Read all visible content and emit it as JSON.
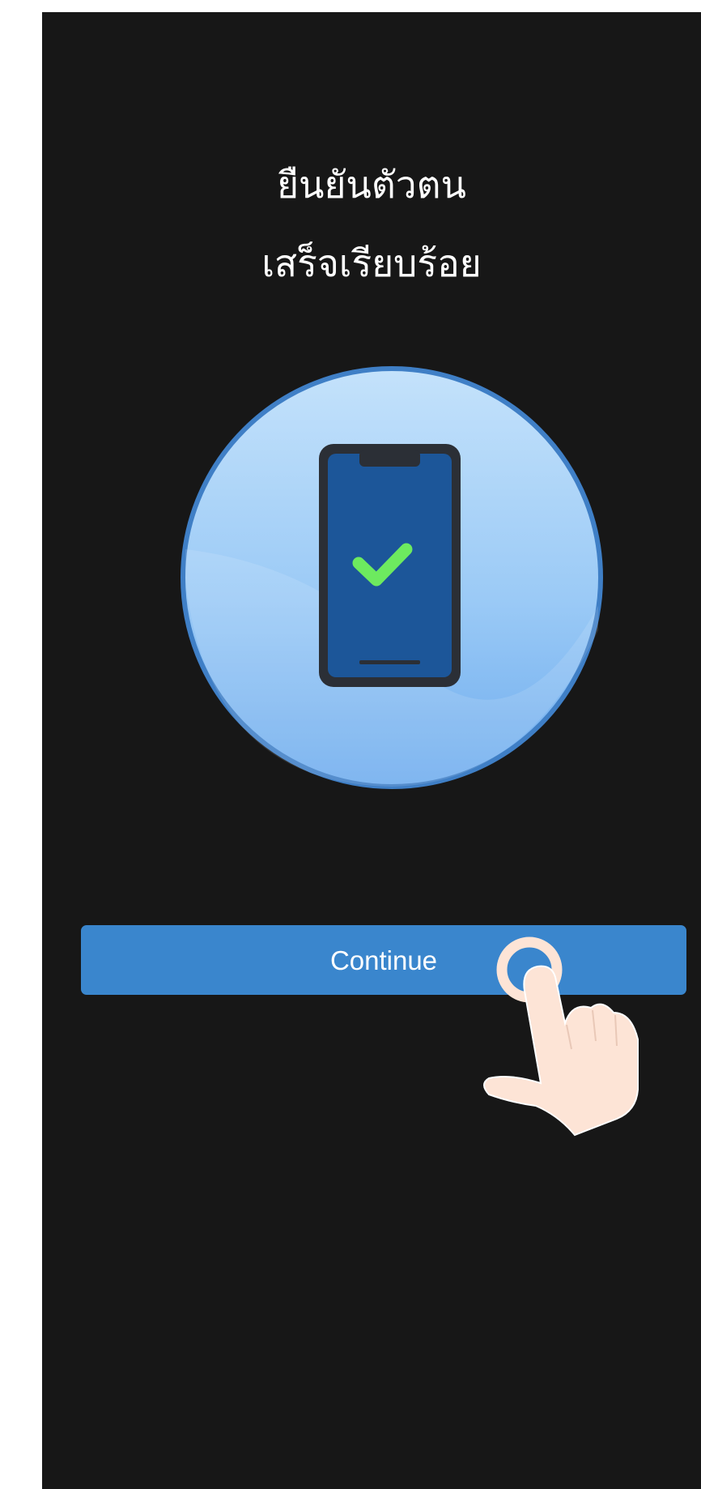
{
  "screen": {
    "title_line1": "ยืนยันตัวตน",
    "title_line2": "เสร็จเรียบร้อย",
    "continue_label": "Continue"
  },
  "icons": {
    "illustration": "phone-verified-icon",
    "tap_hint": "tap-hand-icon"
  },
  "colors": {
    "background": "#171717",
    "button": "#3a86cd",
    "circle": "#8cc3f3",
    "phone_screen": "#1c5699",
    "checkmark": "#6dea5f",
    "hand": "#fde4d6"
  }
}
